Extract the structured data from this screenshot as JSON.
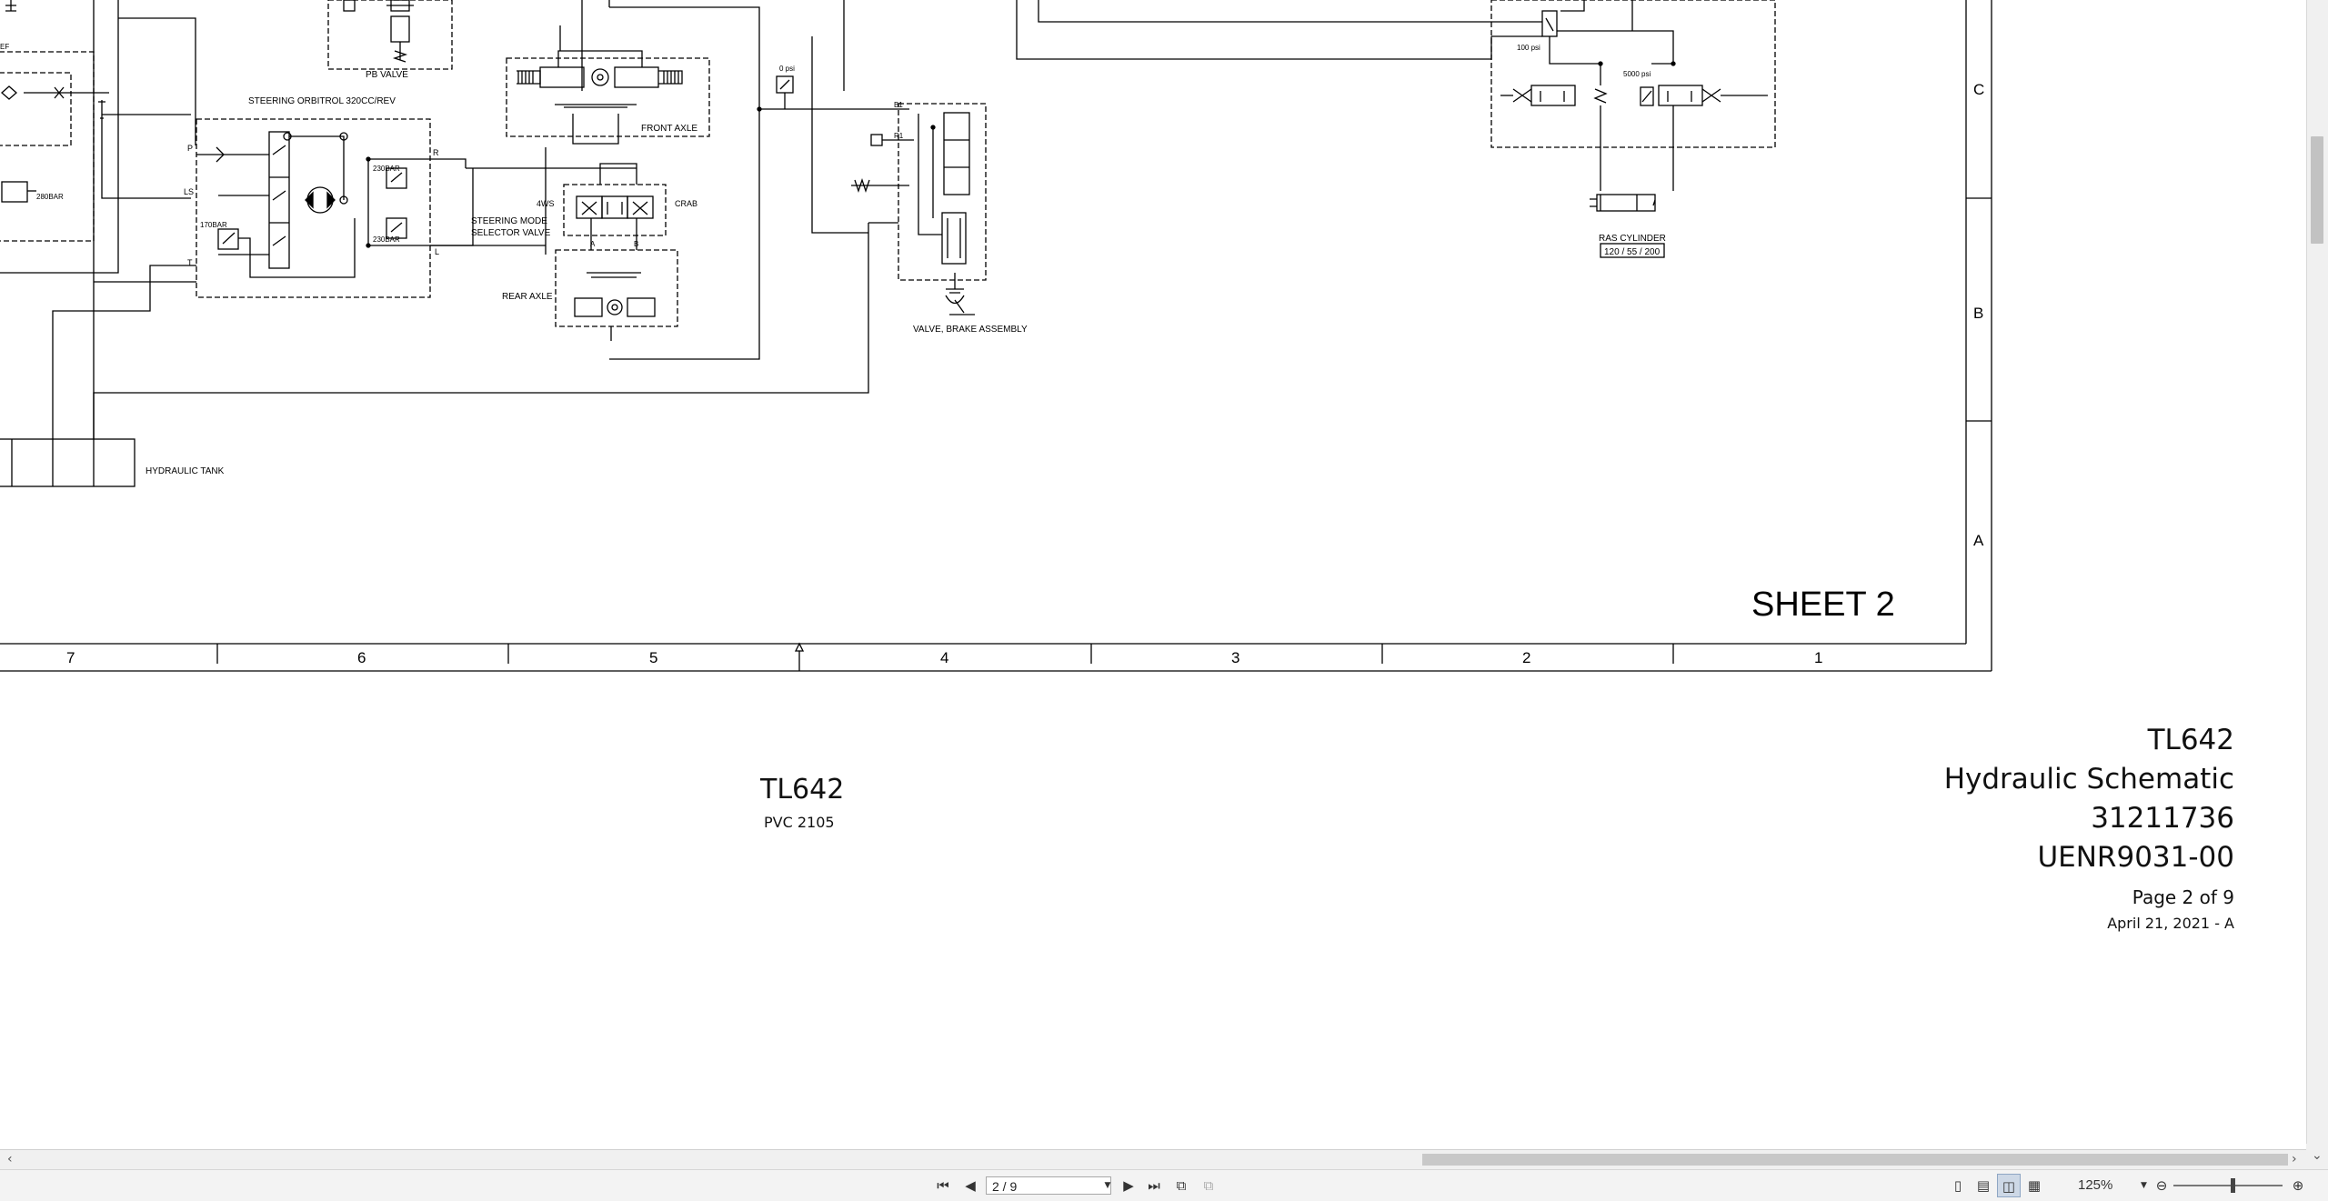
{
  "drawing": {
    "labels": {
      "pb_valve": "PB VALVE",
      "steering_orbitrol": "STEERING ORBITROL 320CC/REV",
      "front_axle": "FRONT AXLE",
      "rear_axle": "REAR AXLE",
      "steering_mode_1": "STEERING MODE",
      "steering_mode_2": "SELECTOR VALVE",
      "four_ws": "4WS",
      "crab": "CRAB",
      "brake_valve": "VALVE, BRAKE ASSEMBLY",
      "hydraulic_tank": "HYDRAULIC TANK",
      "ras_cylinder": "RAS CYLINDER",
      "ras_dims": "120 / 55 / 200",
      "psi_0": "0 psi",
      "psi_100": "100 psi",
      "psi_5000": "5000 psi",
      "bar_170": "170BAR",
      "bar_230_top": "230BAR",
      "bar_230_bottom": "230BAR",
      "bar_280": "280BAR",
      "port_p": "P",
      "port_ls": "LS",
      "port_t": "T",
      "port_r": "R",
      "port_l": "L",
      "port_a": "A",
      "port_b": "B",
      "port_ef": "EF",
      "port_b1": "B1",
      "port_r1": "R1"
    },
    "sheet": "SHEET 2",
    "zone_rows": [
      "C",
      "B",
      "A"
    ],
    "zone_columns": [
      "7",
      "6",
      "5",
      "4",
      "3",
      "2",
      "1"
    ]
  },
  "title_block": {
    "model": "TL642",
    "pvc_model": "TL642",
    "pvc": "PVC 2105",
    "doc_title": "Hydraulic Schematic",
    "part_number": "31211736",
    "doc_number": "UENR9031-00",
    "page": "Page 2 of 9",
    "date": "April 21, 2021 - A"
  },
  "toolbar": {
    "page_field": "2 / 9",
    "zoom": "125%",
    "icons": [
      "first-page-icon",
      "previous-page-icon",
      "next-page-icon",
      "last-page-icon",
      "previous-view-icon",
      "next-view-icon",
      "single-page-view-icon",
      "continuous-view-icon",
      "facing-view-icon",
      "continuous-facing-view-icon",
      "zoom-out-icon",
      "zoom-in-icon"
    ]
  }
}
